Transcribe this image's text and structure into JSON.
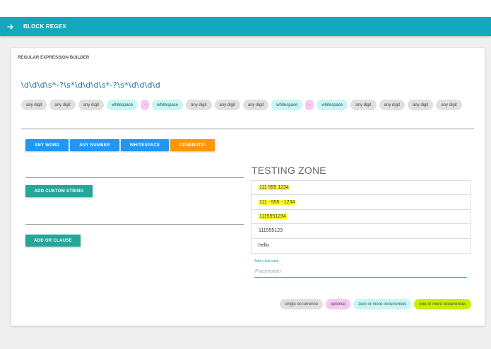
{
  "app": {
    "title": "BLOCK REGEX",
    "back_icon": "arrow-right-icon"
  },
  "builder": {
    "title": "REGULAR EXPRESSION BUILDER",
    "regex": "\\d\\d\\d\\s*-?\\s*\\d\\d\\d\\s*-?\\s*\\d\\d\\d\\d",
    "chips": [
      {
        "label": "any digit",
        "kind": "gray"
      },
      {
        "label": "any digit",
        "kind": "gray"
      },
      {
        "label": "any digit",
        "kind": "gray"
      },
      {
        "label": "whitespace",
        "kind": "cyan"
      },
      {
        "label": "-",
        "kind": "pink"
      },
      {
        "label": "whitespace",
        "kind": "cyan"
      },
      {
        "label": "any digit",
        "kind": "gray"
      },
      {
        "label": "any digit",
        "kind": "gray"
      },
      {
        "label": "any digit",
        "kind": "gray"
      },
      {
        "label": "whitespace",
        "kind": "cyan"
      },
      {
        "label": "-",
        "kind": "pink"
      },
      {
        "label": "whitespace",
        "kind": "cyan"
      },
      {
        "label": "any digit",
        "kind": "gray"
      },
      {
        "label": "any digit",
        "kind": "gray"
      },
      {
        "label": "any digit",
        "kind": "gray"
      },
      {
        "label": "any digit",
        "kind": "gray"
      }
    ],
    "buttons": {
      "any_word": "ANY WORD",
      "any_number": "ANY NUMBER",
      "whitespace": "WHITESPACE",
      "generate": "GENERATE!"
    },
    "add_custom_string": "ADD CUSTOM STRING",
    "add_or_clause": "ADD OR CLAUSE"
  },
  "testing": {
    "title": "TESTING ZONE",
    "cases": [
      {
        "text": "111 555 1234",
        "match": true
      },
      {
        "text": "111 - 555 - 1234",
        "match": true
      },
      {
        "text": "1115551234",
        "match": true
      },
      {
        "text": "111555123",
        "match": false
      },
      {
        "text": "hello",
        "match": false
      }
    ],
    "add_label": "Add a test case",
    "add_placeholder": "Placeholder"
  },
  "legend": [
    {
      "label": "single occurrence",
      "color": "#e0e0e0"
    },
    {
      "label": "optional",
      "color": "#f8c8f4"
    },
    {
      "label": "zero or more occurrences",
      "color": "#c6f7f7"
    },
    {
      "label": "one or more occurrences",
      "color": "#c7f000"
    }
  ],
  "colors": {
    "appbar": "#12a8bd",
    "blue_button": "#2196f3",
    "orange_button": "#ff9800",
    "teal_button": "#26a69a",
    "match_highlight": "#ffff33"
  }
}
